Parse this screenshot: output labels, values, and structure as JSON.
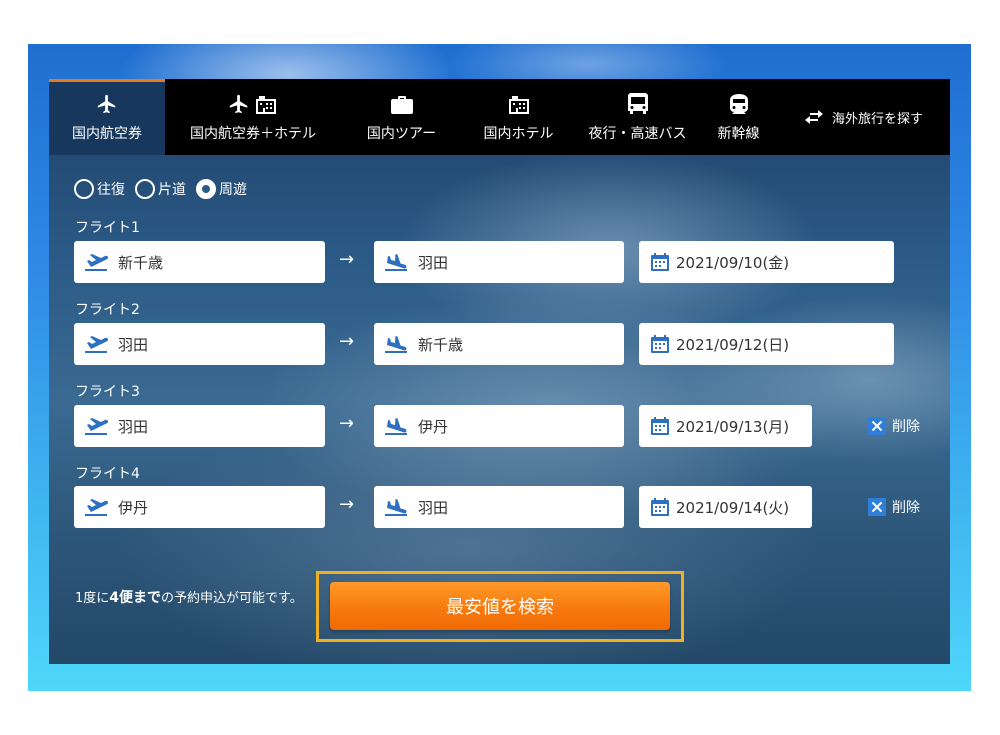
{
  "tabs": [
    {
      "label": "国内航空券",
      "icons": [
        "airplane-icon"
      ],
      "active": true
    },
    {
      "label": "国内航空券＋ホテル",
      "icons": [
        "airplane-icon",
        "hotel-icon"
      ],
      "active": false
    },
    {
      "label": "国内ツアー",
      "icons": [
        "suitcase-icon"
      ],
      "active": false
    },
    {
      "label": "国内ホテル",
      "icons": [
        "hotel-icon"
      ],
      "active": false
    },
    {
      "label": "夜行・高速バス",
      "icons": [
        "bus-icon"
      ],
      "active": false
    },
    {
      "label": "新幹線",
      "icons": [
        "train-icon"
      ],
      "active": false
    }
  ],
  "overseas": {
    "label": "海外旅行を探す",
    "icon": "swap-arrows-icon"
  },
  "trip_types": [
    {
      "label": "往復",
      "checked": false
    },
    {
      "label": "片道",
      "checked": false
    },
    {
      "label": "周遊",
      "checked": true
    }
  ],
  "flights": [
    {
      "label": "フライト1",
      "from": "新千歳",
      "to": "羽田",
      "date": "2021/09/10(金)",
      "deletable": false
    },
    {
      "label": "フライト2",
      "from": "羽田",
      "to": "新千歳",
      "date": "2021/09/12(日)",
      "deletable": false
    },
    {
      "label": "フライト3",
      "from": "羽田",
      "to": "伊丹",
      "date": "2021/09/13(月)",
      "deletable": true
    },
    {
      "label": "フライト4",
      "from": "伊丹",
      "to": "羽田",
      "date": "2021/09/14(火)",
      "deletable": true
    }
  ],
  "arrow": "→",
  "delete_label": "削除",
  "note": {
    "prefix": "1度に",
    "bold": "4便まで",
    "suffix": "の予約申込が可能です。"
  },
  "search_button": "最安値を検索",
  "colors": {
    "accent": "#f77a0e",
    "highlight": "#f2b01e",
    "tab_active": "#18375c",
    "icon_blue": "#2f6fc0"
  }
}
